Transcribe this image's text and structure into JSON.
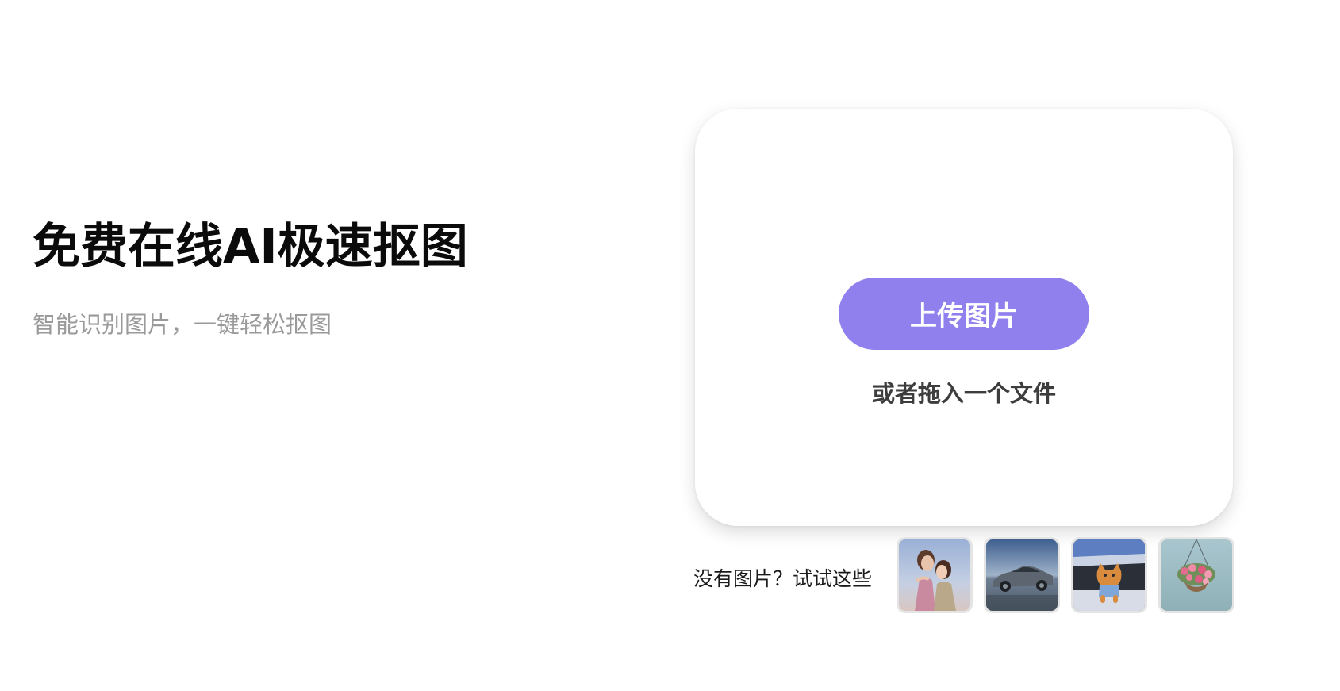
{
  "hero": {
    "title": "免费在线AI极速抠图",
    "subtitle": "智能识别图片，一键轻松抠图"
  },
  "upload": {
    "button_label": "上传图片",
    "drop_hint": "或者拖入一个文件"
  },
  "samples": {
    "label": "没有图片？试试这些",
    "items": [
      "two-women-photo",
      "car-photo",
      "cat-in-car-photo",
      "flower-basket-photo"
    ]
  },
  "colors": {
    "accent": "#9080ee",
    "subtitle": "#9a9a9a",
    "thumb_border": "#e4e4e4"
  }
}
